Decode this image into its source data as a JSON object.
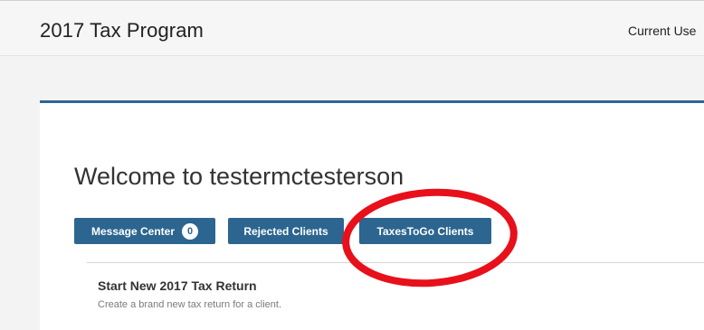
{
  "header": {
    "app_title": "2017 Tax Program",
    "current_user_label": "Current Use"
  },
  "main": {
    "welcome_title": "Welcome to testermctesterson",
    "buttons": {
      "message_center": "Message Center",
      "message_count": "0",
      "rejected_clients": "Rejected Clients",
      "taxestogo_clients": "TaxesToGo Clients"
    },
    "new_return": {
      "title": "Start New 2017 Tax Return",
      "description": "Create a brand new tax return for a client."
    }
  },
  "colors": {
    "primary_button": "#2c6590",
    "panel_accent": "#2f6591",
    "annotation_red": "#e8101a"
  }
}
